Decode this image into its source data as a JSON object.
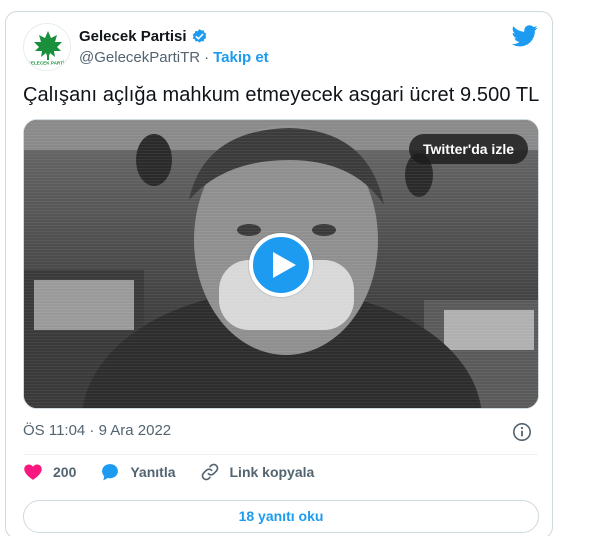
{
  "author": {
    "display_name": "Gelecek Partisi",
    "handle": "@GelecekPartiTR",
    "separator": "·",
    "follow_label": "Takip et",
    "avatar_text": "GELECEK PARTİSİ",
    "verified": true
  },
  "tweet": {
    "text": "Çalışanı açlığa mahkum etmeyecek asgari ücret 9.500 TL",
    "timestamp": "ÖS 11:04 · 9 Ara 2022"
  },
  "media": {
    "watch_label": "Twitter'da izle"
  },
  "actions": {
    "like_count": "200",
    "reply_label": "Yanıtla",
    "copy_link_label": "Link kopyala"
  },
  "footer": {
    "read_replies_label": "18 yanıtı oku"
  },
  "colors": {
    "accent": "#1d9bf0",
    "like": "#f91880",
    "brand_green": "#1a8f3c"
  },
  "icons": [
    "verified-icon",
    "twitter-bird-icon",
    "play-icon",
    "info-icon",
    "heart-icon",
    "reply-bubble-icon",
    "link-icon"
  ]
}
